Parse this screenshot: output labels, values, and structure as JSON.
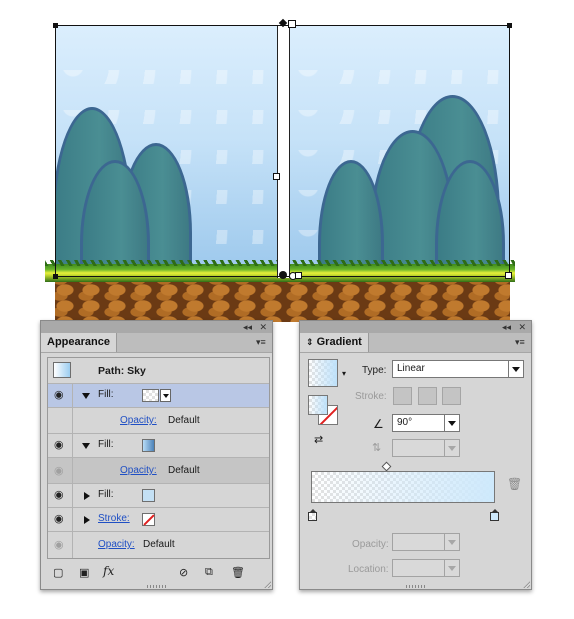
{
  "appearance_panel": {
    "title": "Appearance",
    "path_label": "Path: Sky",
    "rows": [
      {
        "type": "fill",
        "label": "Fill:"
      },
      {
        "type": "opacity",
        "label": "Opacity:",
        "value": "Default"
      },
      {
        "type": "fill",
        "label": "Fill:"
      },
      {
        "type": "opacity",
        "label": "Opacity:",
        "value": "Default"
      },
      {
        "type": "fill",
        "label": "Fill:"
      },
      {
        "type": "stroke",
        "label": "Stroke:"
      },
      {
        "type": "opacity",
        "label": "Opacity:",
        "value": "Default"
      }
    ],
    "fx_label": "fx"
  },
  "gradient_panel": {
    "title": "Gradient",
    "type_label": "Type:",
    "type_value": "Linear",
    "stroke_label": "Stroke:",
    "angle_value": "90°",
    "opacity_label": "Opacity:",
    "location_label": "Location:"
  },
  "colors": {
    "selection_row": "#b9c7e5",
    "link": "#1f4fc4",
    "sky_top": "#dbeefd",
    "sky_bottom": "#9cc8ec",
    "hill": "#4a8e93",
    "grass": "#67b32a",
    "dirt": "#6b3a14"
  },
  "icons": [
    "eye-icon",
    "disclosure-triangle",
    "new-fill-icon",
    "new-stroke-icon",
    "fx-icon",
    "clear-icon",
    "duplicate-icon",
    "trash-icon",
    "collapse-icon",
    "close-icon",
    "panel-menu-icon"
  ]
}
